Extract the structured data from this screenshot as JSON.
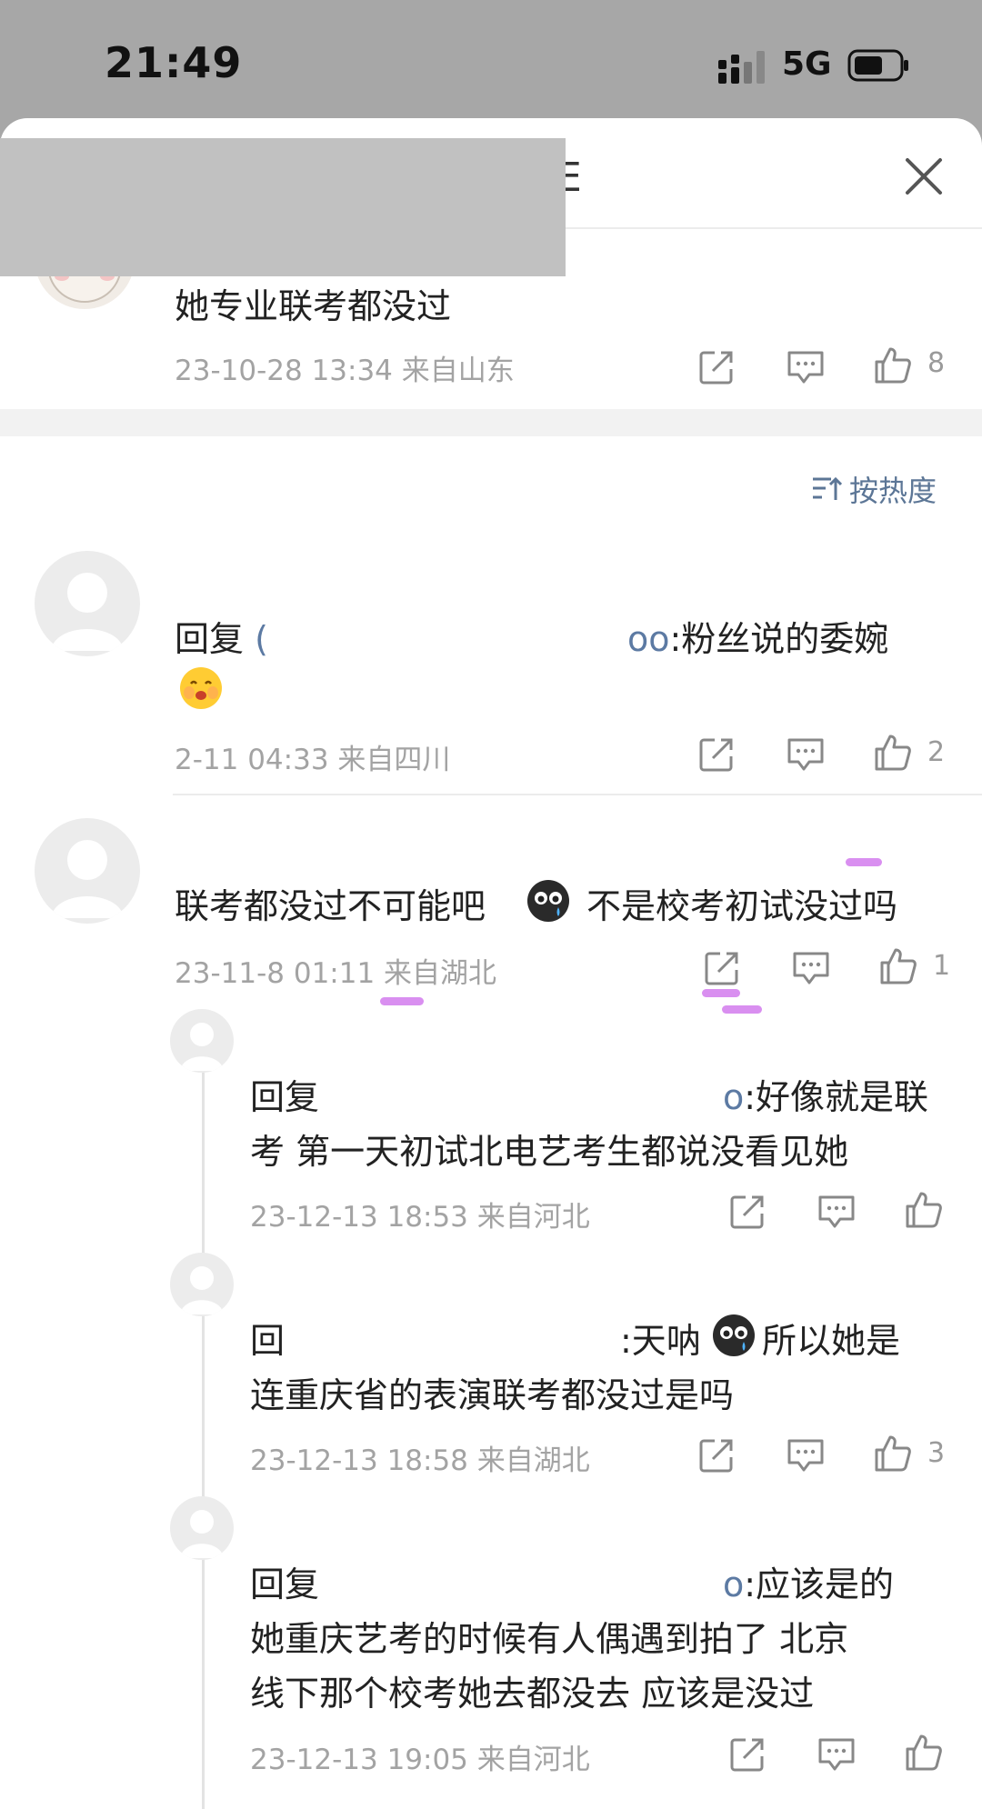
{
  "status_bar": {
    "time": "21:49",
    "network": "5G"
  },
  "sheet": {
    "title_fragment": "E"
  },
  "top_comment": {
    "text": "她专业联考都没过",
    "meta": "23-10-28 13:34  来自山东",
    "likes": "8"
  },
  "sort": {
    "label": "按热度"
  },
  "comments": [
    {
      "reply_prefix": "回复",
      "name_start": "(",
      "name_end": "oo",
      "text_line1": ":粉丝说的委婉",
      "meta": "2-11 04:33  来自四川",
      "likes": "2"
    },
    {
      "text_before_emoji": "联考都没过不可能吧",
      "text_after_emoji": "不是校考初试没过吗",
      "meta": "23-11-8 01:11  来自湖北",
      "likes": "1",
      "replies": [
        {
          "reply_prefix": "回复",
          "name_end": "o",
          "text_line1": ":好像就是联",
          "text_line2": "考 第一天初试北电艺考生都说没看见她",
          "meta": "23-12-13 18:53  来自河北",
          "likes": ""
        },
        {
          "reply_prefix": "回",
          "text_line1a": ":天呐",
          "text_line1b": "所以她是",
          "text_line2": "连重庆省的表演联考都没过是吗",
          "meta": "23-12-13 18:58  来自湖北",
          "likes": "3"
        },
        {
          "reply_prefix": "回复",
          "name_end": "o",
          "text_line1": ":应该是的",
          "text_line2": "她重庆艺考的时候有人偶遇到拍了 北京",
          "text_line3": "线下那个校考她去都没去 应该是没过",
          "meta": "23-12-13 19:05  来自河北",
          "likes": ""
        }
      ]
    }
  ],
  "colors": {
    "accent": "#5c7696",
    "meta": "#a3a3a3",
    "highlight": "#d98ff0"
  }
}
